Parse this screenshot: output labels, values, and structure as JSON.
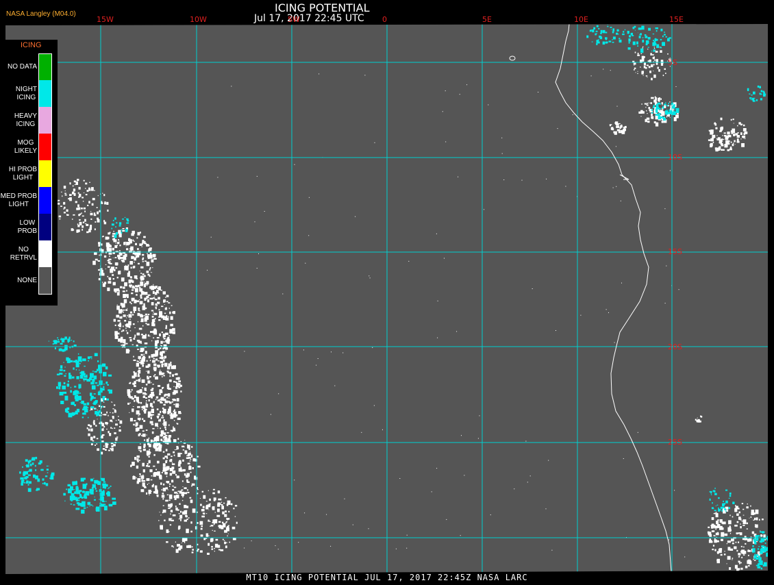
{
  "header": {
    "source_label": "NASA Langley (M04.0)",
    "title": "ICING POTENTIAL",
    "timestamp": "Jul 17, 2017 22:45 UTC"
  },
  "longitude_labels": [
    "15W",
    "10W",
    "5W",
    "0",
    "5E",
    "10E",
    "15E"
  ],
  "latitude_labels": [
    "5S",
    "10S",
    "15S",
    "20S",
    "25S"
  ],
  "legend": {
    "title": "ICING",
    "items": [
      {
        "label": "NO DATA",
        "color": "#00b000"
      },
      {
        "label": "NIGHT\nICING",
        "color": "#00e8e8"
      },
      {
        "label": "HEAVY\nICING",
        "color": "#e8a8e0"
      },
      {
        "label": "MOG\nLIKELY",
        "color": "#ff0000"
      },
      {
        "label": "HI PROB\nLIGHT",
        "color": "#ffff00"
      },
      {
        "label": "MED PROB\nLIGHT",
        "color": "#0000ff"
      },
      {
        "label": "LOW\nPROB",
        "color": "#000080"
      },
      {
        "label": "NO\nRETRVL",
        "color": "#ffffff"
      },
      {
        "label": "NONE",
        "color": "#555555"
      }
    ]
  },
  "footer": {
    "label": "MT10  ICING POTENTIAL  JUL 17, 2017 22:45Z  NASA LARC"
  },
  "colors": {
    "background": "#555555",
    "grid": "#00d0d0",
    "coastline": "#ffffff",
    "night_icing": "#00e8e8",
    "no_retrieval": "#ffffff"
  }
}
